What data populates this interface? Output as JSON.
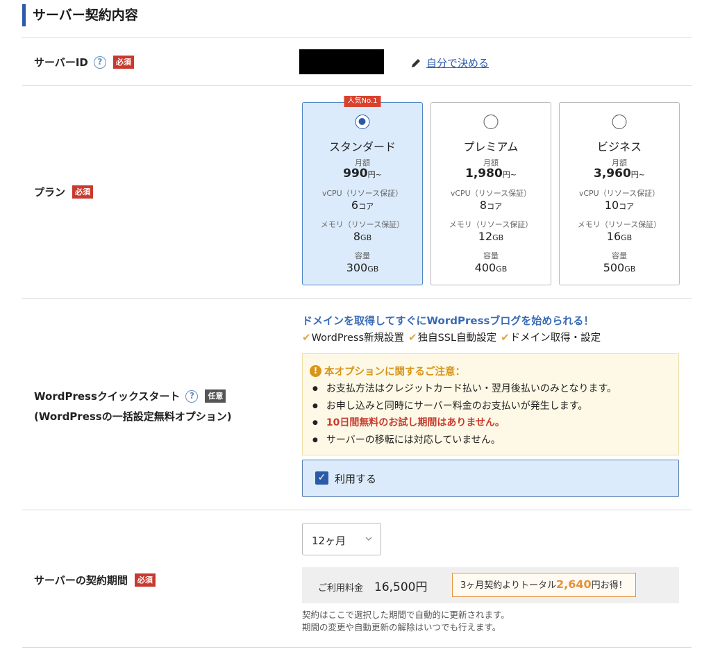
{
  "section": {
    "title": "サーバー契約内容"
  },
  "server_id": {
    "label": "サーバーID",
    "required_badge": "必須",
    "self_link": "自分で決める"
  },
  "plan": {
    "label": "プラン",
    "required_badge": "必須",
    "labels": {
      "monthly": "月額",
      "vcpu": "vCPU（リソース保証）",
      "memory": "メモリ（リソース保証）",
      "storage": "容量"
    },
    "options": [
      {
        "name": "スタンダード",
        "badge": "人気No.1",
        "selected": true,
        "price": "990",
        "price_unit": "円~",
        "vcpu": "6",
        "vcpu_unit": "コア",
        "memory": "8",
        "memory_unit": "GB",
        "storage": "300",
        "storage_unit": "GB"
      },
      {
        "name": "プレミアム",
        "badge": "",
        "selected": false,
        "price": "1,980",
        "price_unit": "円~",
        "vcpu": "8",
        "vcpu_unit": "コア",
        "memory": "12",
        "memory_unit": "GB",
        "storage": "400",
        "storage_unit": "GB"
      },
      {
        "name": "ビジネス",
        "badge": "",
        "selected": false,
        "price": "3,960",
        "price_unit": "円~",
        "vcpu": "10",
        "vcpu_unit": "コア",
        "memory": "16",
        "memory_unit": "GB",
        "storage": "500",
        "storage_unit": "GB"
      }
    ]
  },
  "wp_quickstart": {
    "label_line1": "WordPressクイックスタート",
    "label_line2": "(WordPressの一括設定無料オプション)",
    "optional_badge": "任意",
    "headline": "ドメインを取得してすぐにWordPressブログを始められる！",
    "features": [
      "WordPress新規設置",
      "独自SSL自動設定",
      "ドメイン取得・設定"
    ],
    "notice_title": "本オプションに関するご注意：",
    "notices": [
      {
        "text": "お支払方法はクレジットカード払い・翌月後払いのみとなります。",
        "alert": false
      },
      {
        "text": "お申し込みと同時にサーバー料金のお支払いが発生します。",
        "alert": false
      },
      {
        "text": "10日間無料のお試し期間はありません。",
        "alert": true
      },
      {
        "text": "サーバーの移転には対応していません。",
        "alert": false
      }
    ],
    "use_label": "利用する",
    "use_checked": true
  },
  "term": {
    "label": "サーバーの契約期間",
    "required_badge": "必須",
    "selected": "12ヶ月",
    "fee_label": "ご利用料金",
    "fee_amount": "16,500円",
    "saving_prefix": "3ヶ月契約よりトータル",
    "saving_amount": "2,640",
    "saving_suffix": "円お得！",
    "note_line1": "契約はここで選択した期間で自動的に更新されます。",
    "note_line2": "期間の変更や自動更新の解除はいつでも行えます。"
  },
  "colors": {
    "accent": "#2b5aa8",
    "required": "#c83a2e",
    "highlight": "#e5913a",
    "selected_bg": "#dcebfb"
  }
}
